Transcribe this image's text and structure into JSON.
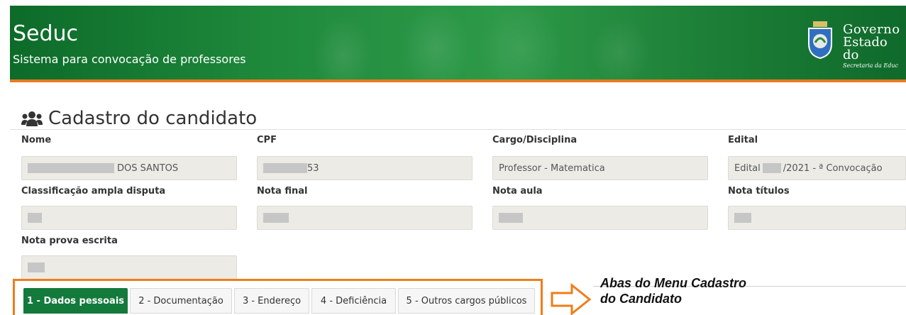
{
  "header": {
    "title": "Seduc",
    "subtitle": "Sistema para convocação de professores",
    "gov_line1": "Governo",
    "gov_line2": "Estado do",
    "gov_line3": "Secretaria da Educ"
  },
  "page": {
    "title": "Cadastro do candidato"
  },
  "fields": {
    "nome": {
      "label": "Nome",
      "value": "DOS SANTOS"
    },
    "cpf": {
      "label": "CPF",
      "value": "53"
    },
    "cargo": {
      "label": "Cargo/Disciplina",
      "value": "Professor - Matematica"
    },
    "edital": {
      "label": "Edital",
      "value_prefix": "Edital",
      "value_suffix": "/2021 - ª Convocação"
    },
    "classificacao": {
      "label": "Classificação ampla disputa",
      "value": ""
    },
    "nota_final": {
      "label": "Nota final",
      "value": ""
    },
    "nota_aula": {
      "label": "Nota aula",
      "value": ""
    },
    "nota_titulos": {
      "label": "Nota títulos",
      "value": ""
    },
    "nota_prova": {
      "label": "Nota prova escrita",
      "value": ""
    }
  },
  "tabs": [
    {
      "label": "1 - Dados pessoais",
      "active": true
    },
    {
      "label": "2 - Documentação",
      "active": false
    },
    {
      "label": "3 - Endereço",
      "active": false
    },
    {
      "label": "4 - Deficiência",
      "active": false
    },
    {
      "label": "5 - Outros cargos públicos",
      "active": false
    }
  ],
  "annotation": {
    "line1": "Abas do Menu Cadastro",
    "line2": "do Candidato"
  },
  "colors": {
    "header_green": "#1f8a3c",
    "accent_orange": "#f07d1a",
    "active_tab": "#137a3c"
  }
}
